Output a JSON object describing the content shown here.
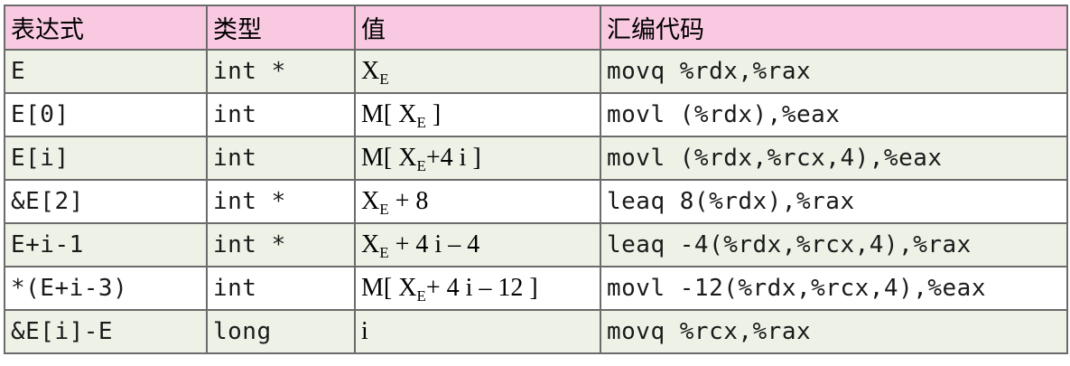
{
  "headers": [
    "表达式",
    "类型",
    "值",
    "汇编代码"
  ],
  "rows": [
    {
      "expr": "E",
      "type": "int *",
      "value": [
        {
          "t": "X"
        },
        {
          "sub": "E"
        }
      ],
      "asm": "movq %rdx,%rax"
    },
    {
      "expr": "E[0]",
      "type": "int",
      "value": [
        {
          "t": "M[ X"
        },
        {
          "sub": "E"
        },
        {
          "t": " ]"
        }
      ],
      "asm": "movl (%rdx),%eax"
    },
    {
      "expr": "E[i]",
      "type": "int",
      "value": [
        {
          "t": "M[ X"
        },
        {
          "sub": "E"
        },
        {
          "t": "+4 i ]"
        }
      ],
      "asm": "movl (%rdx,%rcx,4),%eax"
    },
    {
      "expr": "&E[2]",
      "type": "int *",
      "value": [
        {
          "t": "X"
        },
        {
          "sub": "E"
        },
        {
          "t": " + 8"
        }
      ],
      "asm": "leaq 8(%rdx),%rax"
    },
    {
      "expr": "E+i-1",
      "type": "int *",
      "value": [
        {
          "t": "X"
        },
        {
          "sub": "E"
        },
        {
          "t": " + 4 i – 4"
        }
      ],
      "asm": "leaq -4(%rdx,%rcx,4),%rax"
    },
    {
      "expr": "*(E+i-3)",
      "type": "int",
      "value": [
        {
          "t": "M[ X"
        },
        {
          "sub": "E"
        },
        {
          "t": "+ 4 i – 12 ]"
        }
      ],
      "asm": "movl -12(%rdx,%rcx,4),%eax"
    },
    {
      "expr": "&E[i]-E",
      "type": "long",
      "value": [
        {
          "t": "i"
        }
      ],
      "asm": "movq %rcx,%rax"
    }
  ],
  "colors": {
    "header_bg": "#f9c9e2",
    "shaded_row_bg": "#edf1e6",
    "plain_row_bg": "#ffffff",
    "border": "#6b6b6b"
  }
}
